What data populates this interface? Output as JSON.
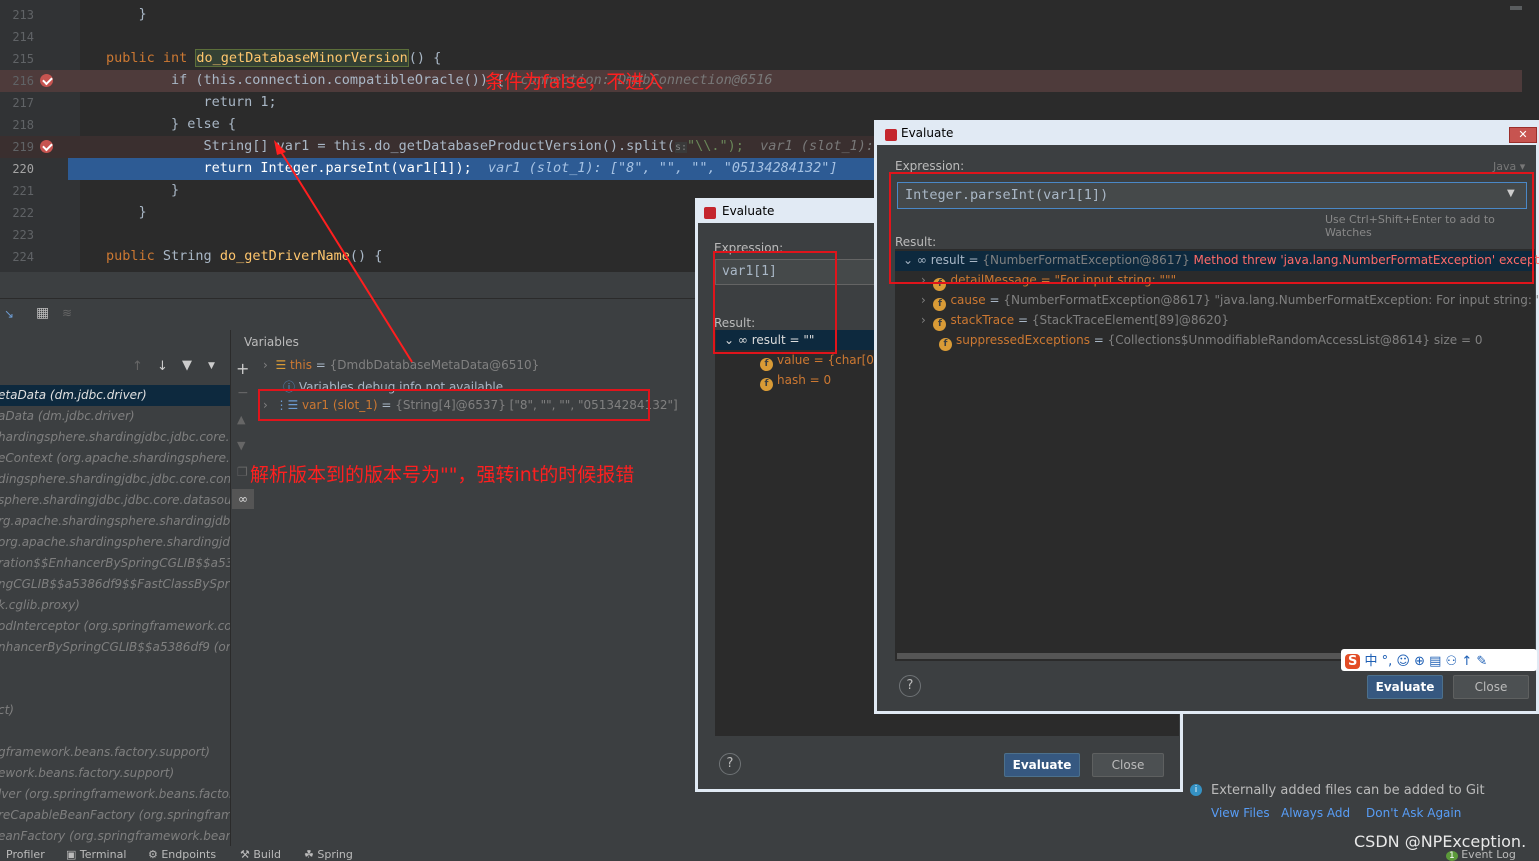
{
  "editor": {
    "lines": [
      {
        "no": "213",
        "code": "    }"
      },
      {
        "no": "214",
        "code": ""
      },
      {
        "no": "215",
        "kw1": "public ",
        "kw2": "int ",
        "fn": "do_getDatabaseMinorVersion",
        "rest": "() {"
      },
      {
        "no": "216",
        "code": "        if (this.connection.compatibleOracle()) {",
        "hint": "connection: DmdbConnection@6516"
      },
      {
        "no": "217",
        "code": "            return 1;"
      },
      {
        "no": "218",
        "code": "        } else {"
      },
      {
        "no": "219",
        "code": "            String[] var1 = this.do_getDatabaseProductVersion().split(",
        "hint": "var1 (slot_1): [\"8",
        "param": "s:",
        "str": "\"\\\\.\");"
      },
      {
        "no": "220",
        "code": "            return Integer.parseInt(var1[1]);",
        "hint": "var1 (slot_1): [\"8\", \"\", \"\", \"05134284132\"]"
      },
      {
        "no": "221",
        "code": "        }"
      },
      {
        "no": "222",
        "code": "    }"
      },
      {
        "no": "223",
        "code": ""
      },
      {
        "no": "224",
        "kw1": "public ",
        "type": "String ",
        "name": "do_getDriverName",
        "rest": "() {"
      }
    ],
    "annotation_top": "条件为false，不进入"
  },
  "frames": {
    "items": [
      "etaData (dm.jdbc.driver)",
      "aData (dm.jdbc.driver)",
      "hardingsphere.shardingjdbc.jdbc.core.d",
      "eContext (org.apache.shardingsphere.s",
      "dingsphere.shardingjdbc.jdbc.core.cont",
      "sphere.shardingjdbc.jdbc.core.datasour",
      "rg.apache.shardingsphere.shardingjdbc",
      "org.apache.shardingsphere.shardingjdb",
      "ration$$EnhancerBySpringCGLIB$$a538",
      "ngCGLIB$$a5386df9$$FastClassBySprin",
      "k.cglib.proxy)",
      "odInterceptor (org.springframework.co",
      "nhancerBySpringCGLIB$$a5386df9 (org.",
      "",
      "",
      "ct)",
      "",
      "gframework.beans.factory.support)",
      "ework.beans.factory.support)",
      "lver (org.springframework.beans.factory",
      "reCapableBeanFactory (org.springframe",
      "eanFactory (org.springframework.beans"
    ]
  },
  "variables": {
    "title": "Variables",
    "this_name": "this",
    "this_val": "{DmdbDatabaseMetaData@6510}",
    "info": "Variables debug info not available",
    "var1_name": "var1 (slot_1)",
    "var1_val": "{String[4]@6537} [\"8\", \"\", \"\", \"05134284132\"]",
    "annotation": "解析版本到的版本号为\"\"，强转int的时候报错"
  },
  "eval_small": {
    "title": "Evaluate",
    "expression_label": "Expression:",
    "expression": "var1[1]",
    "result_label": "Result:",
    "result": "result = \"\"",
    "value": "value = {char[0]@",
    "hash": "hash = 0",
    "evaluate": "Evaluate",
    "close": "Close"
  },
  "eval_big": {
    "title": "Evaluate",
    "expression_label": "Expression:",
    "lang": "Java",
    "expression": "Integer.parseInt(var1[1])",
    "watch_hint": "Use Ctrl+Shift+Enter to add to Watches",
    "result_label": "Result:",
    "result_name": "result",
    "result_val": "{NumberFormatException@8617}",
    "result_msg": "Method threw 'java.lang.NumberFormatException' exceptio",
    "detail": "detailMessage = \"For input string: \"\"\"",
    "cause_name": "cause",
    "cause_val": "{NumberFormatException@8617} \"java.lang.NumberFormatException: For input string: \"\"\"",
    "trace_name": "stackTrace",
    "trace_val": "{StackTraceElement[89]@8620}",
    "supp_name": "suppressedExceptions",
    "supp_val": "{Collections$UnmodifiableRandomAccessList@8614}  size = 0",
    "evaluate": "Evaluate",
    "close": "Close"
  },
  "notification": {
    "text": "Externally added files can be added to Git",
    "view": "View Files",
    "always": "Always Add",
    "dont": "Don't Ask Again"
  },
  "bottom_tabs": [
    "Profiler",
    "Terminal",
    "Endpoints",
    "Build",
    "Spring"
  ],
  "event_log": "Event Log",
  "watermark": "CSDN @NPException."
}
